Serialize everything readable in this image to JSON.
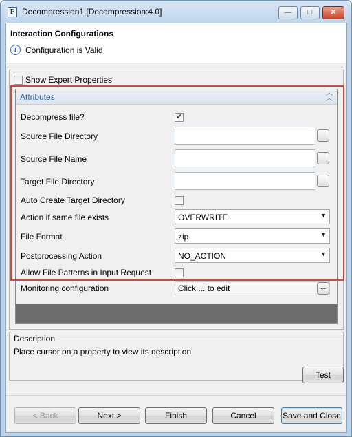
{
  "window": {
    "app_icon": "F",
    "title": "Decompression1 [Decompression:4.0]",
    "controls": {
      "minimize": "—",
      "maximize": "□",
      "close": "✕"
    }
  },
  "header": {
    "title": "Interaction Configurations",
    "status": "Configuration is Valid",
    "status_icon": "info-icon"
  },
  "main": {
    "expert_label": "Show Expert Properties",
    "expert_checked": false,
    "section_title": "Attributes",
    "properties": {
      "decompress": {
        "label": "Decompress file?",
        "checked": true
      },
      "source_dir": {
        "label": "Source File Directory",
        "value": ""
      },
      "source_name": {
        "label": "Source File Name",
        "value": ""
      },
      "target_dir": {
        "label": "Target File Directory",
        "value": ""
      },
      "auto_create": {
        "label": "Auto Create Target Directory",
        "checked": false
      },
      "action_exists": {
        "label": "Action if same file exists",
        "value": "OVERWRITE"
      },
      "file_format": {
        "label": "File Format",
        "value": "zip"
      },
      "postprocessing": {
        "label": "Postprocessing Action",
        "value": "NO_ACTION"
      },
      "allow_patterns": {
        "label": "Allow File Patterns in Input Request",
        "checked": false
      }
    },
    "monitoring": {
      "label": "Monitoring configuration",
      "value": "Click ... to edit"
    },
    "ellipsis": "..."
  },
  "description": {
    "title": "Description",
    "text": "Place cursor on a property to view its description"
  },
  "buttons": {
    "test": "Test",
    "back": "< Back",
    "next": "Next >",
    "finish": "Finish",
    "cancel": "Cancel",
    "save_close": "Save and Close"
  },
  "colors": {
    "highlight_box": "#d9443c",
    "section_title": "#2f5f9c",
    "info": "#2f6db5"
  }
}
